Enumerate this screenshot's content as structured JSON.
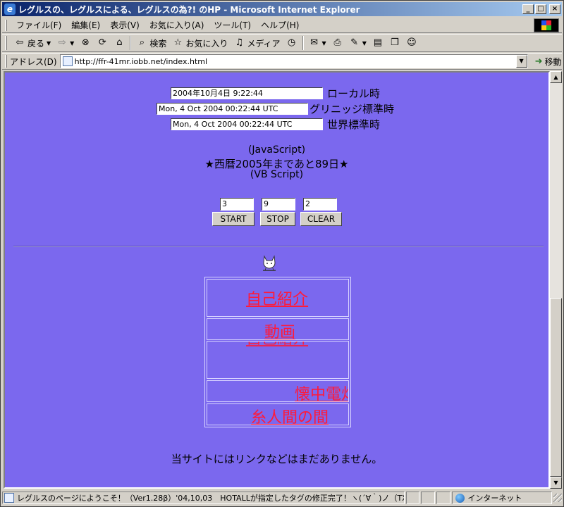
{
  "window": {
    "title": "レグルスの、レグルスによる、レグルスの為?! のHP - Microsoft Internet Explorer",
    "buttons": {
      "minimize": "_",
      "maximize": "□",
      "close": "×"
    }
  },
  "menubar": {
    "items": [
      "ファイル(F)",
      "編集(E)",
      "表示(V)",
      "お気に入り(A)",
      "ツール(T)",
      "ヘルプ(H)"
    ]
  },
  "toolbar": {
    "back_label": "戻る",
    "search_label": "検索",
    "favorites_label": "お気に入り",
    "media_label": "メディア"
  },
  "addressbar": {
    "label": "アドレス(D)",
    "url": "http://ffr-41mr.iobb.net/index.html",
    "go_label": "移動"
  },
  "page": {
    "clocks": [
      {
        "value": "2004年10月4日 9:22:44",
        "label": "ローカル時"
      },
      {
        "value": "Mon, 4 Oct 2004 00:22:44 UTC",
        "label": "グリニッジ標準時"
      },
      {
        "value": "Mon, 4 Oct 2004 00:22:44 UTC",
        "label": "世界標準時"
      }
    ],
    "javascript_note": "(JavaScript)",
    "countdown": "★西暦2005年まであと89日★",
    "vbscript_note": "(VB Script)",
    "stopwatch": {
      "fields": [
        "3",
        "9",
        "2"
      ],
      "start_label": "START",
      "stop_label": "STOP",
      "clear_label": "CLEAR"
    },
    "links": {
      "self_intro": "自己紹介",
      "video": "動画",
      "flashlight": "懐中電灯",
      "thread_room": "糸人間の間"
    },
    "footer_note": "当サイトにはリンクなどはまだありません。"
  },
  "statusbar": {
    "message": "レグルスのページにようこそ！（Ver1.28β）'04,10,03　HOTALLが指定したタグの修正完了！ヽ(´∀｀)ノ（TXTタグも増",
    "zone": "インターネット"
  }
}
